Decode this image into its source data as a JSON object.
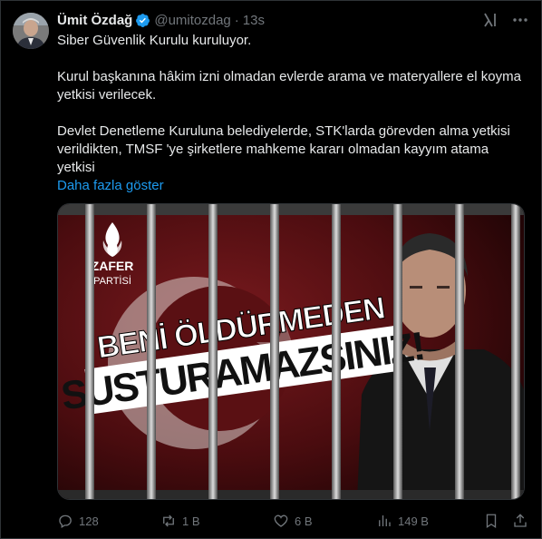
{
  "author": {
    "name": "Ümit Özdağ",
    "handle": "@umitozdag",
    "separator": "·",
    "time": "13s"
  },
  "tweet": {
    "line1": "Siber Güvenlik Kurulu kuruluyor.",
    "para2": "Kurul başkanına hâkim izni olmadan evlerde arama ve materyallere el koyma yetkisi verilecek.",
    "para3": "Devlet Denetleme Kuruluna belediyelerde, STK'larda görevden alma yetkisi verildikten, TMSF 'ye şirketlere mahkeme kararı olmadan kayyım atama yetkisi",
    "show_more": "Daha fazla göster"
  },
  "media": {
    "logo_line1": "ZAFER",
    "logo_line2": "PARTİSİ",
    "headline1": "BENİ ÖLDÜRMEDEN",
    "headline2": "SUSTURAMAZSINIZ!"
  },
  "actions": {
    "replies": "128",
    "reposts": "1 B",
    "likes": "6 B",
    "views": "149 B"
  },
  "colors": {
    "link": "#1d9bf0",
    "verified": "#1d9bf0",
    "muted": "#71767b"
  }
}
